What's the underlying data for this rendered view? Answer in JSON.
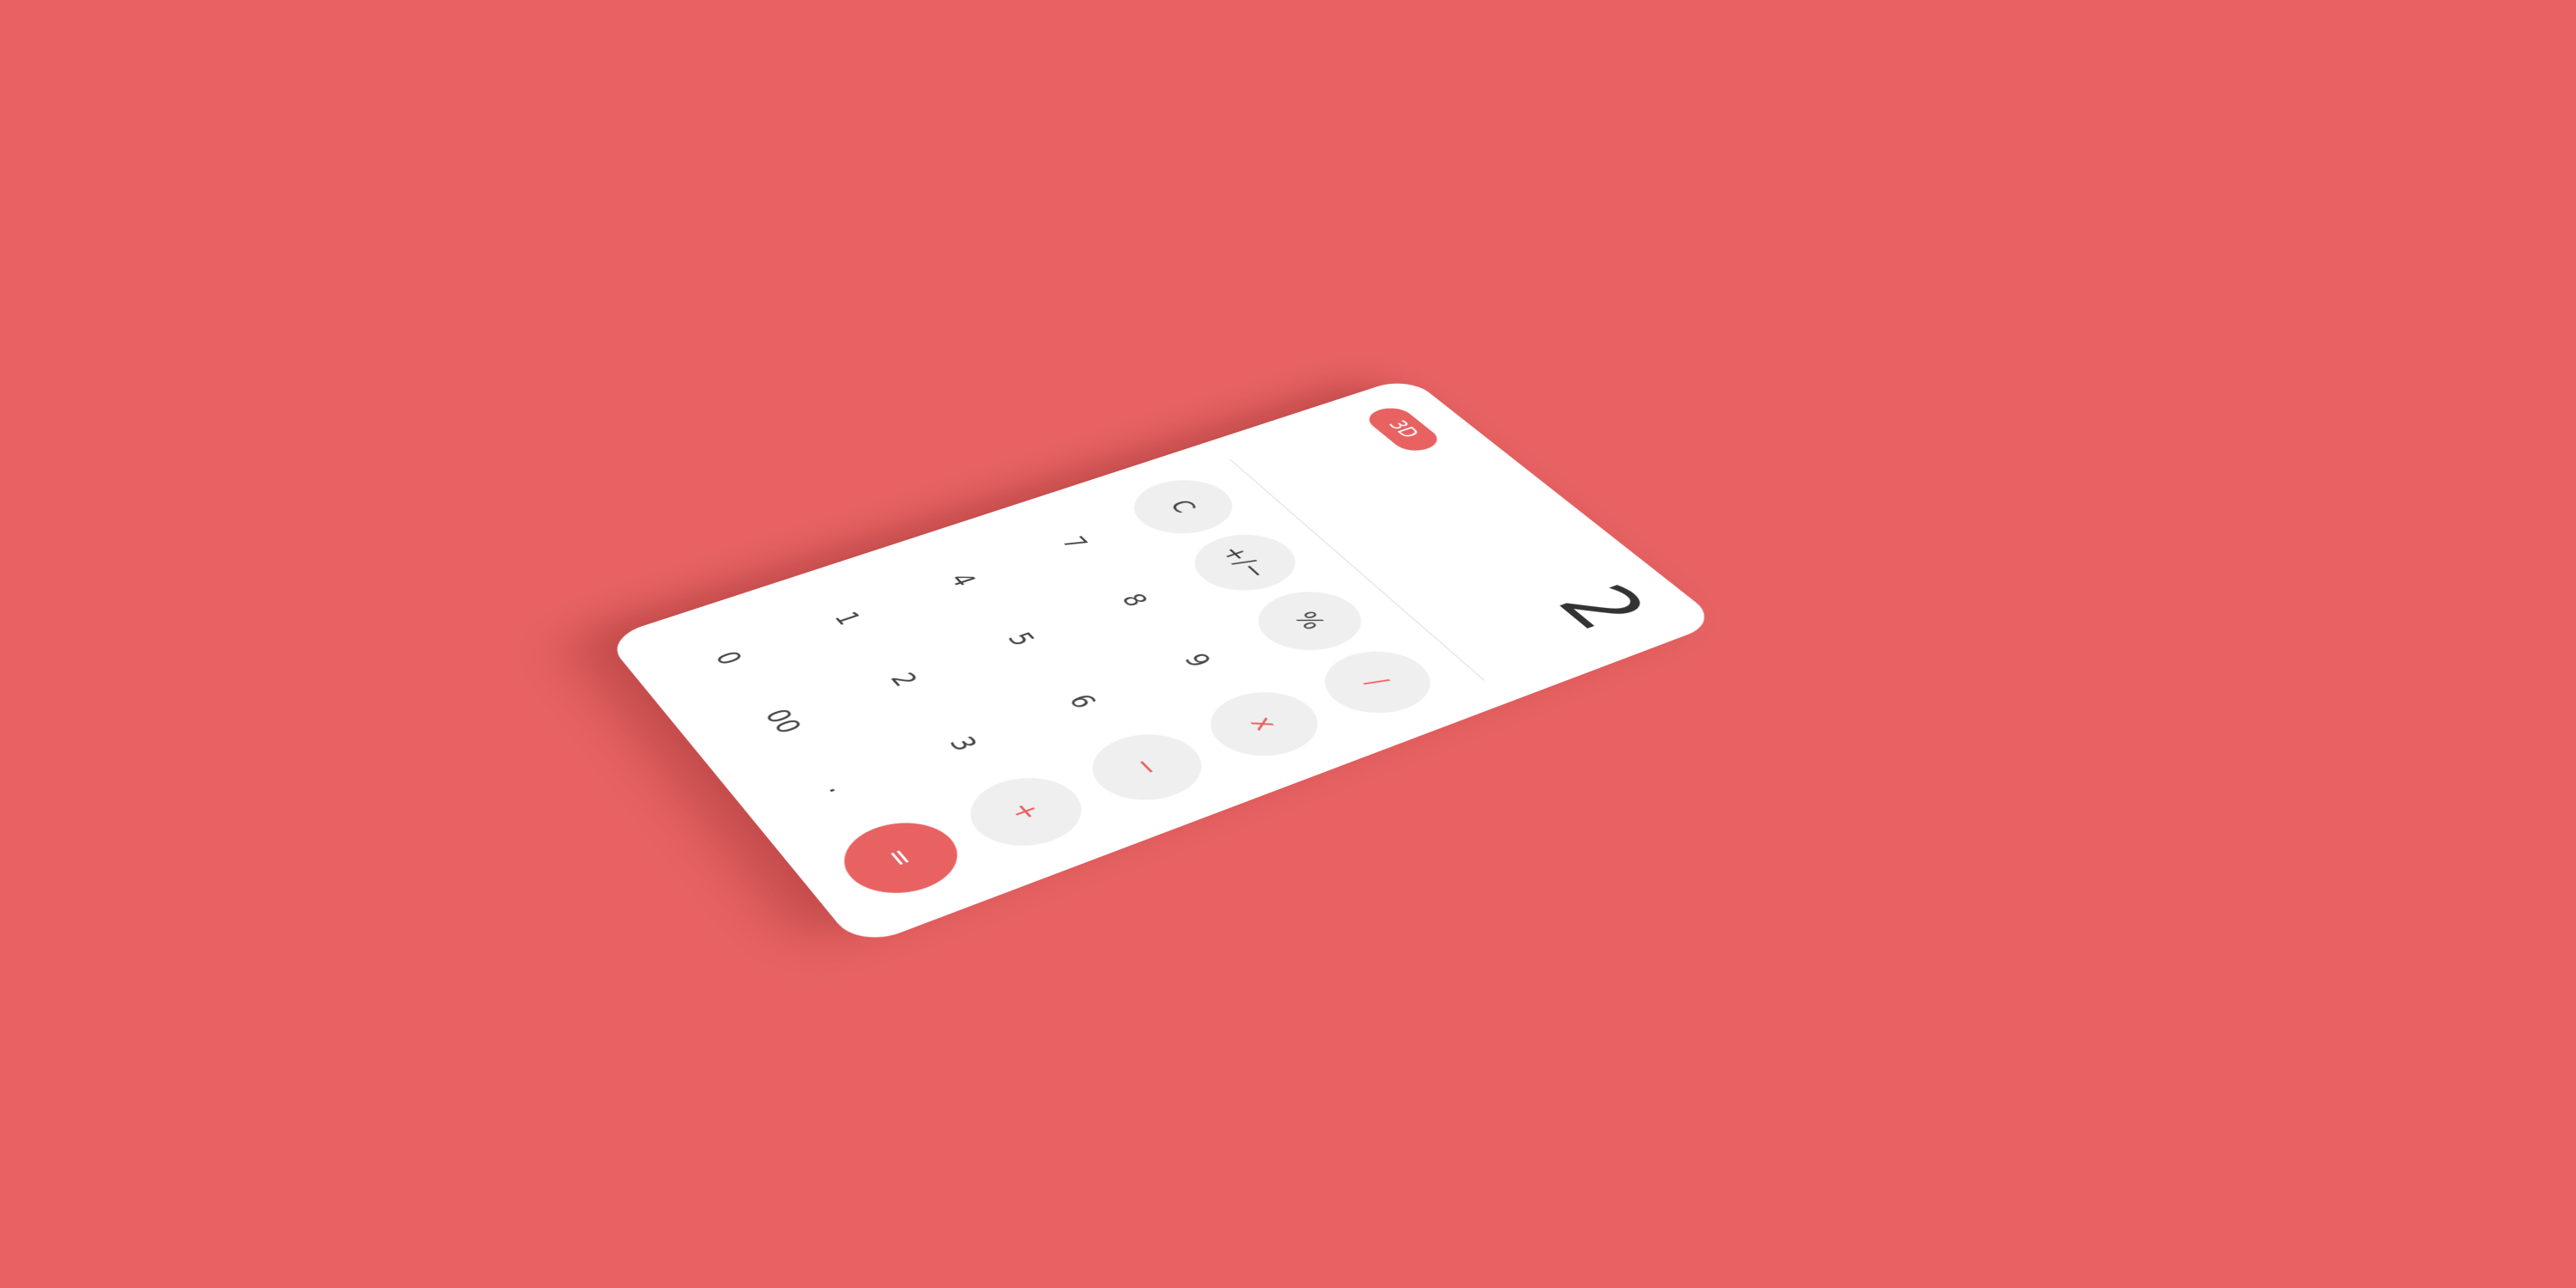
{
  "colors": {
    "background": "#e86262",
    "accent": "#e86262",
    "panel": "#ffffff",
    "key_fill": "#efefef",
    "text": "#333333"
  },
  "toggle": {
    "label": "3D"
  },
  "display": {
    "value": "2"
  },
  "keys": {
    "clear": "C",
    "sign": "+/−",
    "percent": "%",
    "divide": "/",
    "seven": "7",
    "eight": "8",
    "nine": "9",
    "multiply": "x",
    "four": "4",
    "five": "5",
    "six": "6",
    "minus": "−",
    "one": "1",
    "two": "2",
    "three": "3",
    "plus": "+",
    "zero": "0",
    "double_zero": "00",
    "decimal": ".",
    "equals": "="
  }
}
